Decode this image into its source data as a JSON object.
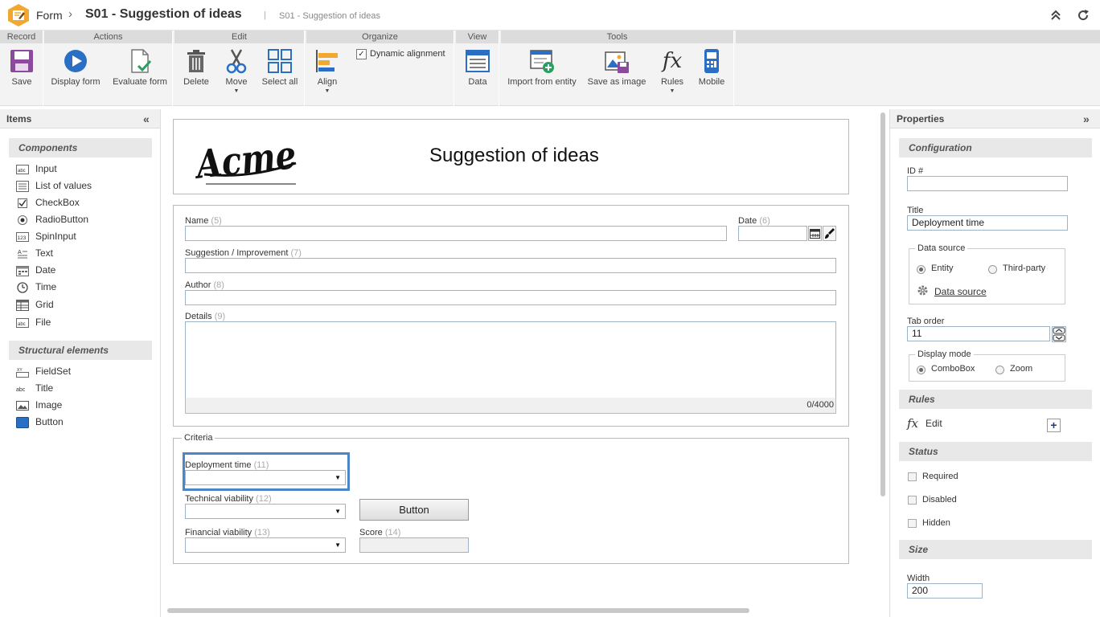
{
  "titlebar": {
    "breadcrumb_root": "Form",
    "separator": "›",
    "title": "S01 - Suggestion of ideas",
    "pipe": "|",
    "subtitle": "S01 - Suggestion of ideas"
  },
  "ribbon": {
    "groups": {
      "record": "Record",
      "actions": "Actions",
      "edit": "Edit",
      "organize": "Organize",
      "view": "View",
      "tools": "Tools"
    },
    "buttons": {
      "save": "Save",
      "display_form": "Display form",
      "evaluate_form": "Evaluate form",
      "delete": "Delete",
      "move": "Move",
      "select_all": "Select all",
      "align": "Align",
      "dynamic_alignment": "Dynamic alignment",
      "data": "Data",
      "import_from_entity": "Import from entity",
      "save_as_image": "Save as image",
      "rules": "Rules",
      "mobile": "Mobile"
    },
    "dynamic_alignment_checked": true
  },
  "items_panel": {
    "title": "Items",
    "components_header": "Components",
    "components": [
      "Input",
      "List of values",
      "CheckBox",
      "RadioButton",
      "SpinInput",
      "Text",
      "Date",
      "Time",
      "Grid",
      "File"
    ],
    "structural_header": "Structural elements",
    "structural": [
      "FieldSet",
      "Title",
      "Image",
      "Button"
    ]
  },
  "form": {
    "logo_text": "Acme",
    "title": "Suggestion of ideas",
    "fields": {
      "name": {
        "label": "Name",
        "num": "(5)"
      },
      "date": {
        "label": "Date",
        "num": "(6)"
      },
      "suggestion": {
        "label": "Suggestion / Improvement",
        "num": "(7)"
      },
      "author": {
        "label": "Author",
        "num": "(8)"
      },
      "details": {
        "label": "Details",
        "num": "(9)",
        "counter": "0/4000"
      }
    },
    "criteria": {
      "legend": "Criteria",
      "deployment": {
        "label": "Deployment time",
        "num": "(11)"
      },
      "technical": {
        "label": "Technical viability",
        "num": "(12)"
      },
      "financial": {
        "label": "Financial viability",
        "num": "(13)"
      },
      "score": {
        "label": "Score",
        "num": "(14)"
      },
      "button": "Button"
    }
  },
  "properties_panel": {
    "title": "Properties",
    "configuration_header": "Configuration",
    "id_label": "ID #",
    "id_value": "",
    "title_label": "Title",
    "title_value": "Deployment time",
    "data_source_legend": "Data source",
    "entity_option": "Entity",
    "third_party_option": "Third-party",
    "data_source_link": "Data source",
    "tab_order_label": "Tab order",
    "tab_order_value": "11",
    "display_mode_legend": "Display mode",
    "combobox_option": "ComboBox",
    "zoom_option": "Zoom",
    "rules_header": "Rules",
    "rules_edit": "Edit",
    "status_header": "Status",
    "required": "Required",
    "disabled": "Disabled",
    "hidden": "Hidden",
    "size_header": "Size",
    "width_label": "Width",
    "width_value": "200"
  },
  "colors": {
    "accent_blue": "#2a6fc4",
    "selected_border": "#4a86c8",
    "logo_orange": "#f0a830"
  }
}
